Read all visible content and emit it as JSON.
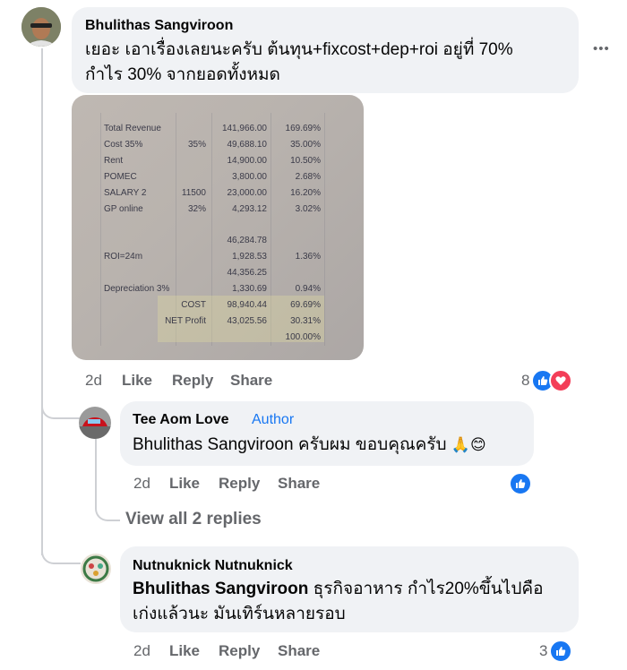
{
  "comment1": {
    "author": "Bhulithas Sangviroon",
    "text_line1": "เยอะ เอาเรื่องเลยนะครับ ต้นทุน+fixcost+dep+roi อยู่ที่ 70%",
    "text_line2": "กำไร 30% จากยอดทั้งหมด",
    "more_label": "•••",
    "time": "2d",
    "like_label": "Like",
    "reply_label": "Reply",
    "share_label": "Share",
    "reaction_count": "8",
    "reactions": [
      "like-icon",
      "love-icon"
    ]
  },
  "spreadsheet": {
    "rows": [
      {
        "label": "Total Revenue",
        "pct_input": "",
        "amount": "141,966.00",
        "ratio": "169.69%"
      },
      {
        "label": "Cost 35%",
        "pct_input": "35%",
        "amount": "49,688.10",
        "ratio": "35.00%"
      },
      {
        "label": "Rent",
        "pct_input": "",
        "amount": "14,900.00",
        "ratio": "10.50%"
      },
      {
        "label": "POMEC",
        "pct_input": "",
        "amount": "3,800.00",
        "ratio": "2.68%"
      },
      {
        "label": "SALARY 2",
        "pct_input": "11500",
        "amount": "23,000.00",
        "ratio": "16.20%"
      },
      {
        "label": "GP online",
        "pct_input": "32%",
        "amount": "4,293.12",
        "ratio": "3.02%"
      },
      {
        "label": "",
        "pct_input": "",
        "amount": "",
        "ratio": ""
      },
      {
        "label": "",
        "pct_input": "",
        "amount": "46,284.78",
        "ratio": ""
      },
      {
        "label": "ROI=24m",
        "pct_input": "",
        "amount": "1,928.53",
        "ratio": "1.36%"
      },
      {
        "label": "",
        "pct_input": "",
        "amount": "44,356.25",
        "ratio": ""
      },
      {
        "label": "Depreciation 3%",
        "pct_input": "",
        "amount": "1,330.69",
        "ratio": "0.94%"
      },
      {
        "label": "",
        "pct_input": "COST",
        "amount": "98,940.44",
        "ratio": "69.69%"
      },
      {
        "label": "",
        "pct_input": "NET Profit",
        "amount": "43,025.56",
        "ratio": "30.31%"
      },
      {
        "label": "",
        "pct_input": "",
        "amount": "",
        "ratio": "100.00%"
      }
    ]
  },
  "reply1": {
    "author": "Tee Aom Love",
    "badge": "Author",
    "mention": "Bhulithas Sangviroon",
    "text": " ครับผม ขอบคุณครับ ",
    "emoji1": "🙏",
    "emoji2": "😊",
    "time": "2d",
    "like_label": "Like",
    "reply_label": "Reply",
    "share_label": "Share",
    "reactions": [
      "like-icon"
    ]
  },
  "view_replies": "View all 2 replies",
  "reply2": {
    "author": "Nutnuknick Nutnuknick",
    "mention": "Bhulithas Sangviroon",
    "text_line1_rest": " ธุรกิจอาหาร กำไร20%ขึ้นไปคือ",
    "text_line2": "เก่งแล้วนะ มันเทิร์นหลายรอบ",
    "time": "2d",
    "like_label": "Like",
    "reply_label": "Reply",
    "share_label": "Share",
    "reaction_count": "3",
    "reactions": [
      "like-icon"
    ]
  },
  "colors": {
    "like": "#1877f2",
    "love": "#f33e58",
    "author_badge": "#1877f2",
    "bubble": "#f0f2f5",
    "meta": "#65676b"
  }
}
